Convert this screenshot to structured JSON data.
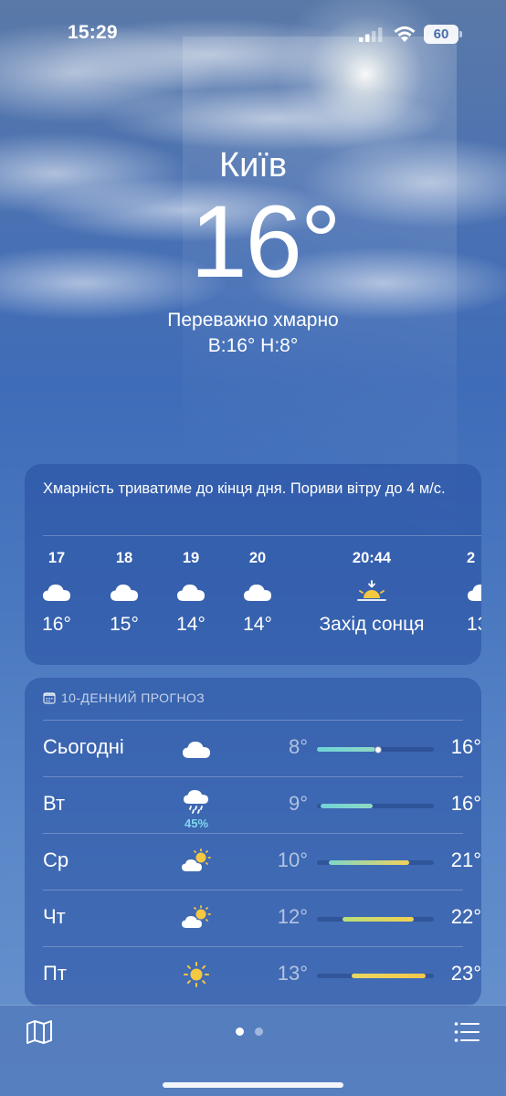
{
  "status_bar": {
    "time": "15:29",
    "battery": "60"
  },
  "header": {
    "city": "Київ",
    "temperature": "16°",
    "condition": "Переважно хмарно",
    "hi_lo": "В:16°  Н:8°"
  },
  "hourly": {
    "summary": "Хмарність триватиме до кінця дня. Пориви вітру до 4 м/с.",
    "items": [
      {
        "hour": "17",
        "icon": "cloud-icon",
        "temp": "16°"
      },
      {
        "hour": "18",
        "icon": "cloud-icon",
        "temp": "15°"
      },
      {
        "hour": "19",
        "icon": "cloud-icon",
        "temp": "14°"
      },
      {
        "hour": "20",
        "icon": "cloud-icon",
        "temp": "14°"
      },
      {
        "hour": "20:44",
        "icon": "sunset-icon",
        "temp": "Захід сонця"
      },
      {
        "hour": "2",
        "icon": "cloud-icon",
        "temp": "13"
      }
    ]
  },
  "forecast": {
    "title": "10-ДЕННИЙ ПРОГНОЗ",
    "days": [
      {
        "day": "Сьогодні",
        "icon": "cloud-icon",
        "precip": "",
        "low": "8°",
        "high": "16°",
        "range_start": 0.0,
        "range_end": 0.5,
        "current": 0.52,
        "color_start": "#6fd3d8",
        "color_end": "#8fd9c4"
      },
      {
        "day": "Вт",
        "icon": "cloud-rain-icon",
        "precip": "45%",
        "low": "9°",
        "high": "16°",
        "range_start": 0.03,
        "range_end": 0.48,
        "color_start": "#6fd3d8",
        "color_end": "#8fd9c4"
      },
      {
        "day": "Ср",
        "icon": "partly-cloudy-icon",
        "precip": "",
        "low": "10°",
        "high": "21°",
        "range_start": 0.1,
        "range_end": 0.79,
        "color_start": "#7fd8c8",
        "color_end": "#f0d25a"
      },
      {
        "day": "Чт",
        "icon": "partly-cloudy-icon",
        "precip": "",
        "low": "12°",
        "high": "22°",
        "range_start": 0.22,
        "range_end": 0.83,
        "color_start": "#b8e07a",
        "color_end": "#f3d050"
      },
      {
        "day": "Пт",
        "icon": "sun-icon",
        "precip": "",
        "low": "13°",
        "high": "23°",
        "range_start": 0.3,
        "range_end": 0.93,
        "color_start": "#e8d860",
        "color_end": "#f5c84a"
      }
    ]
  }
}
